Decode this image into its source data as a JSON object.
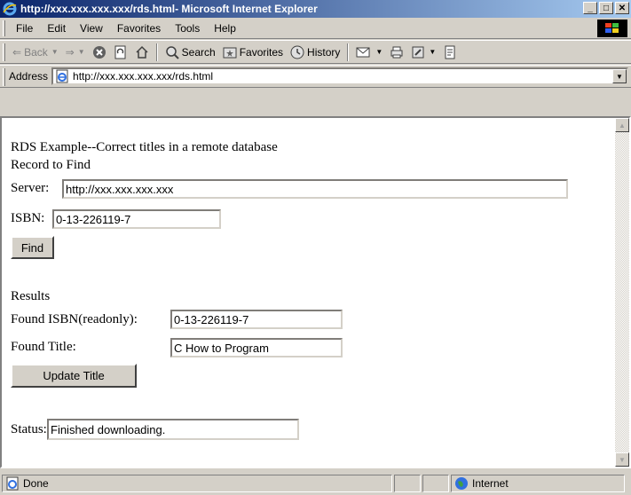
{
  "window": {
    "title": "http://xxx.xxx.xxx.xxx/rds.html- Microsoft Internet Explorer",
    "minimize_label": "_",
    "maximize_label": "□",
    "close_label": "✕"
  },
  "menu": {
    "items": [
      {
        "label": "File"
      },
      {
        "label": "Edit"
      },
      {
        "label": "View"
      },
      {
        "label": "Favorites"
      },
      {
        "label": "Tools"
      },
      {
        "label": "Help"
      }
    ]
  },
  "toolbar": {
    "back_label": "Back",
    "search_label": "Search",
    "favorites_label": "Favorites",
    "history_label": "History"
  },
  "address": {
    "label": "Address",
    "url": "http://xxx.xxx.xxx.xxx/rds.html"
  },
  "page": {
    "heading": "RDS Example--Correct titles in a remote database",
    "record_label": "Record to Find",
    "server_label": "Server:",
    "server_value": "http://xxx.xxx.xxx.xxx",
    "isbn_label": "ISBN:",
    "isbn_value": "0-13-226119-7",
    "find_button": "Find",
    "results_label": "Results",
    "found_isbn_label": "Found ISBN(readonly):",
    "found_isbn_value": "0-13-226119-7",
    "found_title_label": "Found Title:",
    "found_title_value": "C How to Program",
    "update_button": "Update Title",
    "status_label": "Status:",
    "status_value": "Finished downloading."
  },
  "statusbar": {
    "status_text": "Done",
    "zone_text": "Internet"
  }
}
